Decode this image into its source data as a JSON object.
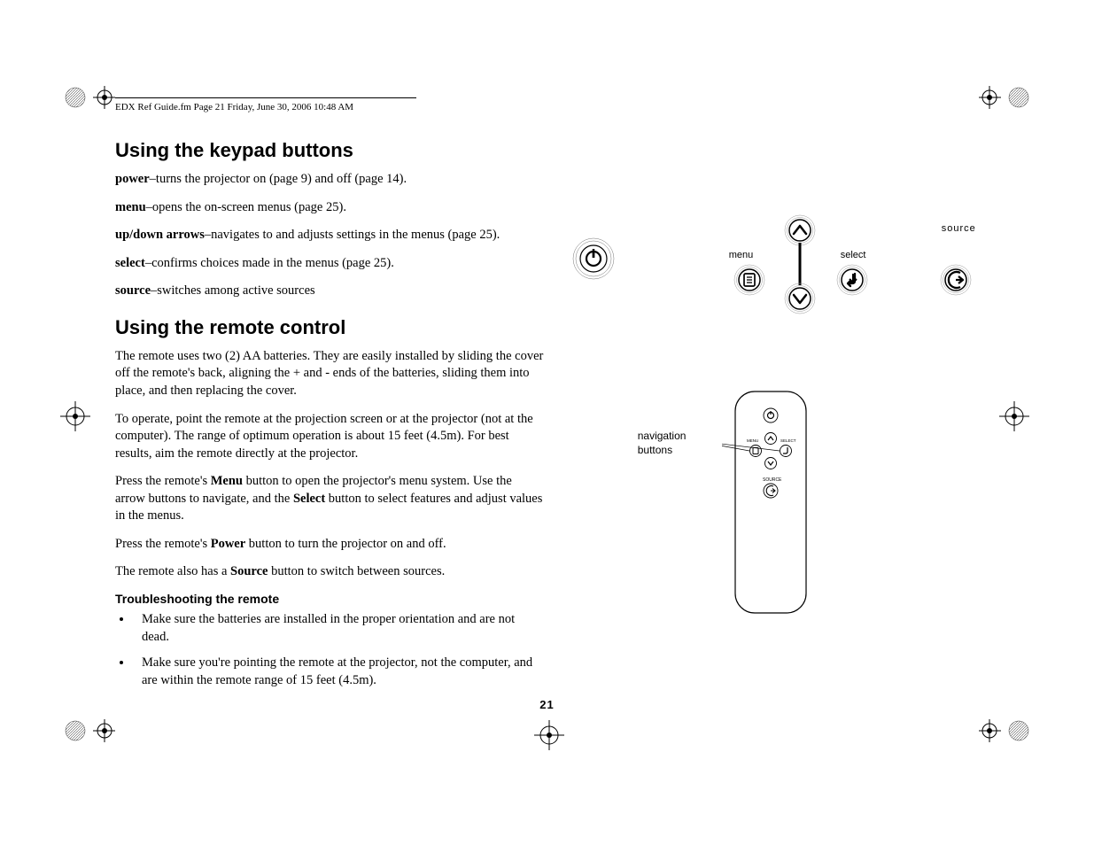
{
  "header": "EDX Ref Guide.fm  Page 21  Friday, June 30, 2006  10:48 AM",
  "h1": "Using the keypad buttons",
  "p_power": {
    "b": "power",
    "t": "–turns the projector on (page 9) and off (page 14)."
  },
  "p_menu": {
    "b": "menu",
    "t": "–opens the on-screen menus (page 25)."
  },
  "p_arrows": {
    "b": "up/down arrows",
    "t": "–navigates to and adjusts settings in the menus (page 25)."
  },
  "p_select": {
    "b": "select",
    "t": "–confirms choices made in the menus (page 25)."
  },
  "p_source": {
    "b": "source",
    "t": "–switches among active sources"
  },
  "h2": "Using the remote control",
  "remote_p1": "The remote uses two (2) AA batteries. They are easily installed by sliding the cover off the remote's back, aligning the + and - ends of the batteries, sliding them into place, and then replacing the cover.",
  "remote_p2": "To operate, point the remote at the projection screen or at the projector (not at the computer). The range of optimum operation is about 15 feet (4.5m). For best results, aim the remote directly at the projector.",
  "remote_p3_a": "Press the remote's ",
  "remote_p3_b1": "Menu",
  "remote_p3_c": " button to open the projector's menu system. Use the arrow buttons to navigate, and the ",
  "remote_p3_b2": "Select",
  "remote_p3_d": " button to select features and adjust values in the menus.",
  "remote_p4_a": "Press the remote's ",
  "remote_p4_b": "Power",
  "remote_p4_c": " button to turn the projector on and off.",
  "remote_p5_a": "The remote also has a ",
  "remote_p5_b": "Source",
  "remote_p5_c": " button to switch between sources.",
  "troubleshoot_h": "Troubleshooting the remote",
  "bullet1": "Make sure the batteries are installed in the proper orientation and are not dead.",
  "bullet2": "Make sure you're pointing the remote at the projector, not the computer, and are within the remote range of 15 feet (4.5m).",
  "page_num": "21",
  "labels": {
    "menu": "menu",
    "select": "select",
    "source": "source",
    "nav": "navigation\nbuttons"
  }
}
